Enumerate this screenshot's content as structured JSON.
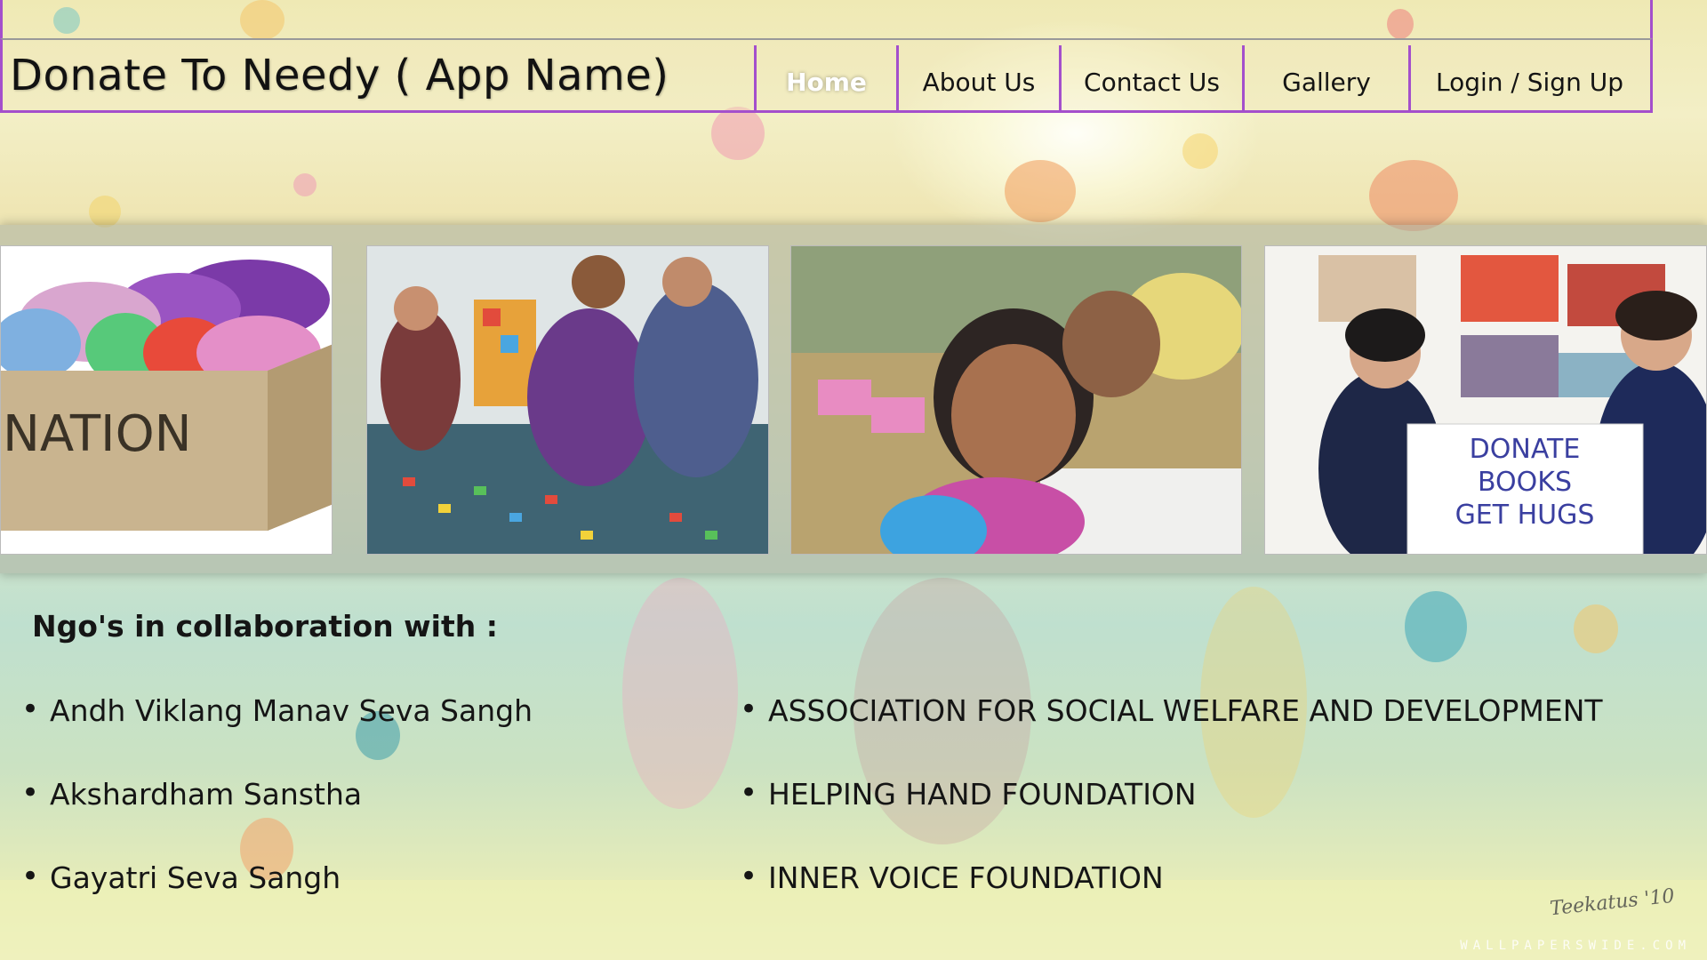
{
  "app": {
    "title": "Donate To Needy ( App Name)"
  },
  "nav": {
    "home": "Home",
    "about": "About Us",
    "contact": "Contact Us",
    "gallery": "Gallery",
    "login": "Login / Sign Up"
  },
  "gallery": {
    "photo1_text": "NATION",
    "photo4_sign": [
      "DONATE",
      "BOOKS",
      "GET HUGS"
    ]
  },
  "ngo": {
    "heading": "Ngo's in collaboration with :",
    "left": [
      "Andh Viklang Manav Seva Sangh",
      "Akshardham Sanstha",
      "Gayatri Seva Sangh"
    ],
    "right": [
      "ASSOCIATION FOR SOCIAL WELFARE AND DEVELOPMENT",
      "HELPING HAND FOUNDATION",
      "INNER VOICE FOUNDATION"
    ]
  },
  "footer": {
    "signature": "Teekatus '10",
    "watermark": "WALLPAPERSWIDE.COM"
  },
  "colors": {
    "nav_border": "#a44fcc",
    "active_nav": "#ffffff",
    "text": "#151515"
  }
}
